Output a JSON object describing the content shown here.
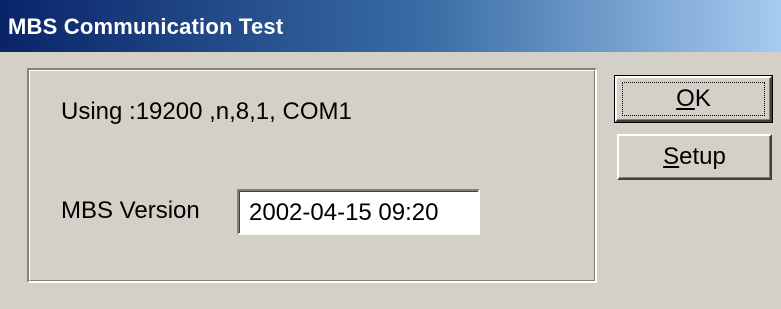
{
  "window": {
    "title": "MBS Communication Test"
  },
  "connection": {
    "using_text": "Using :19200 ,n,8,1, COM1"
  },
  "version": {
    "label": "MBS Version",
    "value": "2002-04-15  09:20"
  },
  "buttons": {
    "ok": {
      "accel": "O",
      "rest": "K"
    },
    "setup": {
      "accel": "S",
      "rest": "etup"
    }
  }
}
